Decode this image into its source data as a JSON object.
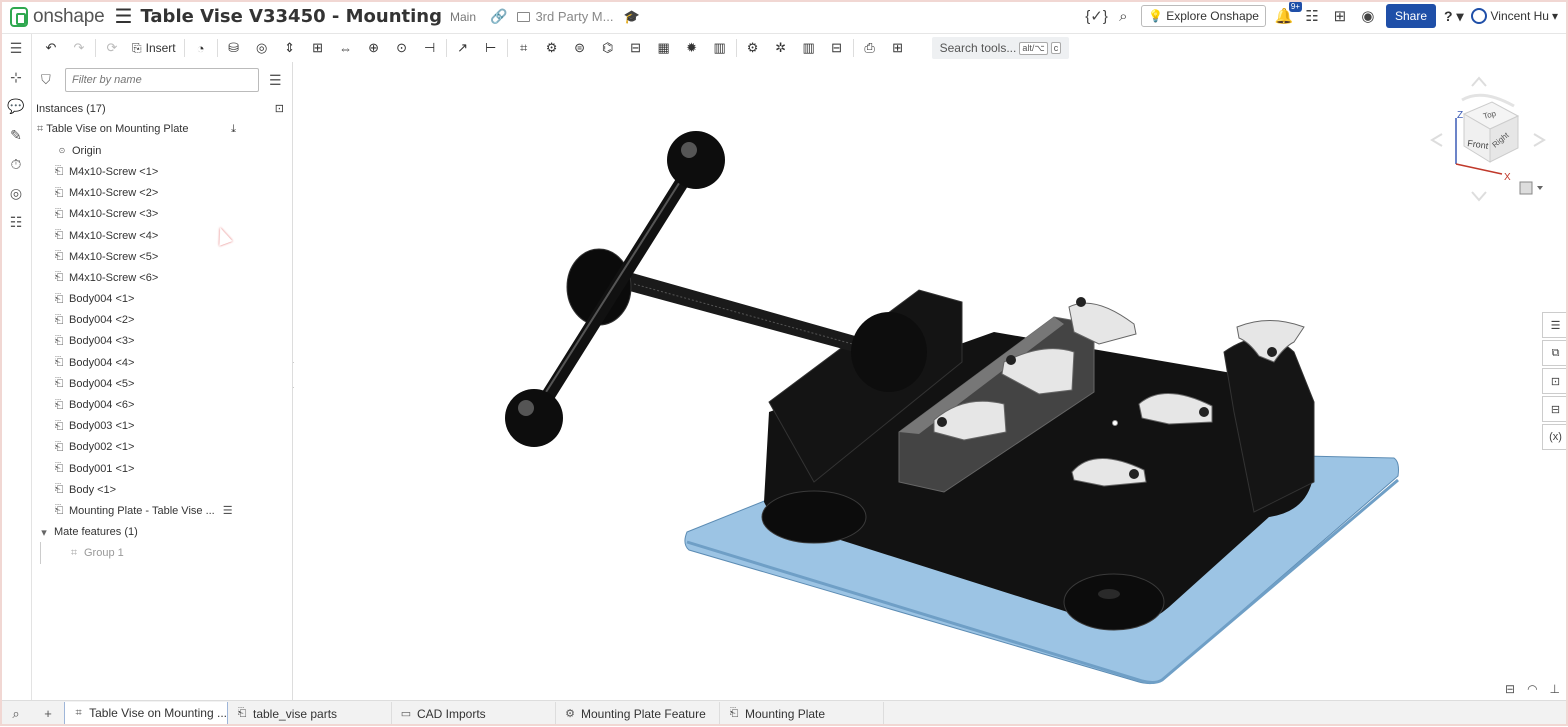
{
  "app": {
    "brand": "onshape"
  },
  "document": {
    "title": "Table Vise V33450 - Mounting",
    "branch": "Main",
    "folder": "3rd Party M..."
  },
  "header": {
    "explore_label": "Explore Onshape",
    "notification_count": "9+",
    "share_label": "Share",
    "help_label": "?",
    "user_name": "Vincent Hu",
    "accent_color": "#1f4fa8"
  },
  "toolbar": {
    "insert_label": "Insert",
    "search_label": "Search tools...",
    "shortcut_key1": "alt/⌥",
    "shortcut_key2": "c"
  },
  "panel": {
    "filter_placeholder": "Filter by name",
    "instances_label": "Instances (17)",
    "assembly": "Table Vise on Mounting Plate",
    "origin": "Origin",
    "parts": [
      "M4x10-Screw <1>",
      "M4x10-Screw <2>",
      "M4x10-Screw <3>",
      "M4x10-Screw <4>",
      "M4x10-Screw <5>",
      "M4x10-Screw <6>",
      "Body004 <1>",
      "Body004 <2>",
      "Body004 <3>",
      "Body004 <4>",
      "Body004 <5>",
      "Body004 <6>",
      "Body003 <1>",
      "Body002 <1>",
      "Body001 <1>",
      "Body <1>",
      "Mounting Plate - Table Vise ..."
    ],
    "mate_features_label": "Mate features (1)",
    "group_label": "Group 1"
  },
  "viewcube": {
    "top": "Top",
    "front": "Front",
    "right": "Right",
    "axis_x": "X",
    "axis_z": "Z"
  },
  "tabs": [
    {
      "label": "Table Vise on Mounting ...",
      "icon": "assembly-icon",
      "active": true
    },
    {
      "label": "table_vise parts",
      "icon": "part-studio-icon",
      "active": false
    },
    {
      "label": "CAD Imports",
      "icon": "folder-icon",
      "active": false
    },
    {
      "label": "Mounting Plate Feature",
      "icon": "feature-studio-icon",
      "active": false
    },
    {
      "label": "Mounting Plate",
      "icon": "part-studio-icon",
      "active": false
    }
  ],
  "colors": {
    "brand_green": "#2fa84f",
    "plate_blue": "#9cc4e4",
    "vise_black": "#111111"
  }
}
